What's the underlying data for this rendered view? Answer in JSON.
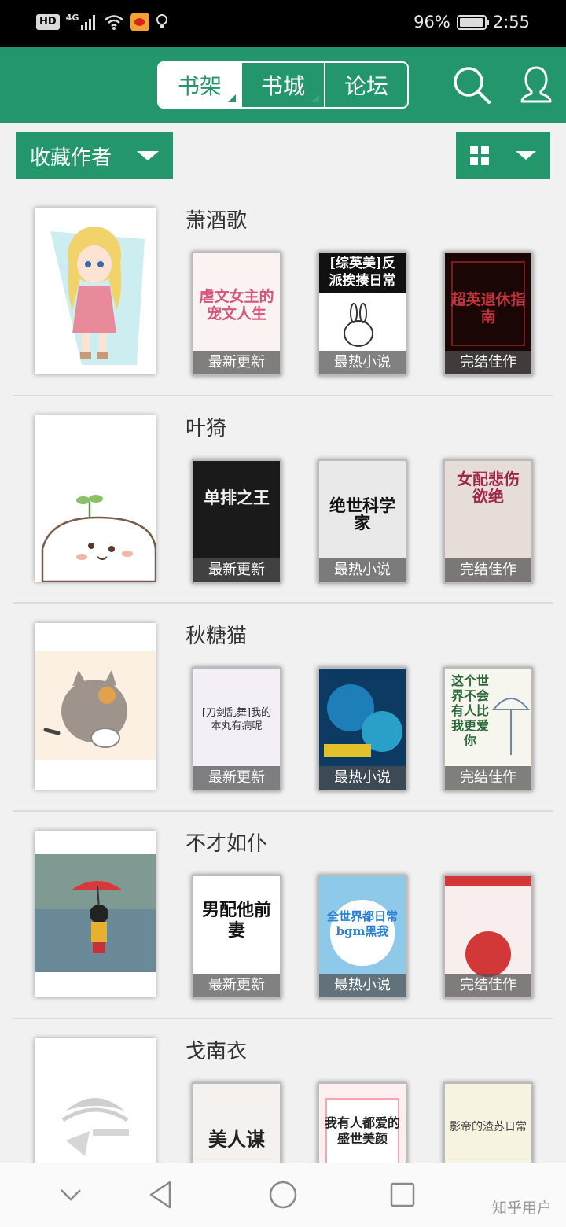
{
  "status_bar": {
    "badge": "HD",
    "network": "4G",
    "battery": "96%",
    "time": "2:55"
  },
  "header": {
    "tabs": [
      {
        "label": "书架",
        "active": true
      },
      {
        "label": "书城",
        "active": false
      },
      {
        "label": "论坛",
        "active": false
      }
    ],
    "accent_color": "#23976b"
  },
  "toolbar": {
    "filter_label": "收藏作者"
  },
  "authors": [
    {
      "name": "萧酒歌",
      "books": [
        {
          "caption": "最新更新",
          "cover_text": "虐文女主的宠文人生"
        },
        {
          "caption": "最热小说",
          "cover_text": "[综英美]反派挨揍日常"
        },
        {
          "caption": "完结佳作",
          "cover_text": "超英退休指南"
        }
      ]
    },
    {
      "name": "叶猗",
      "books": [
        {
          "caption": "最新更新",
          "cover_text": "单排之王"
        },
        {
          "caption": "最热小说",
          "cover_text": "绝世科学家"
        },
        {
          "caption": "完结佳作",
          "cover_text": "女配悲伤欲绝"
        }
      ]
    },
    {
      "name": "秋糖猫",
      "books": [
        {
          "caption": "最新更新",
          "cover_text": "[刀剑乱舞]我的本丸有病呢"
        },
        {
          "caption": "最热小说",
          "cover_text": ""
        },
        {
          "caption": "完结佳作",
          "cover_text": "这个世界不会有人比我更爱你"
        }
      ]
    },
    {
      "name": "不才如仆",
      "books": [
        {
          "caption": "最新更新",
          "cover_text": "男配他前妻"
        },
        {
          "caption": "最热小说",
          "cover_text": "全世界都日常bgm黑我"
        },
        {
          "caption": "完结佳作",
          "cover_text": ""
        }
      ]
    },
    {
      "name": "戈南衣",
      "books": [
        {
          "caption": "",
          "cover_text": "美人谋"
        },
        {
          "caption": "",
          "cover_text": "我有人都爱的盛世美颜"
        },
        {
          "caption": "",
          "cover_text": "影帝的渣苏日常"
        }
      ]
    }
  ],
  "nav_bar": {
    "watermark": "知乎用户"
  }
}
